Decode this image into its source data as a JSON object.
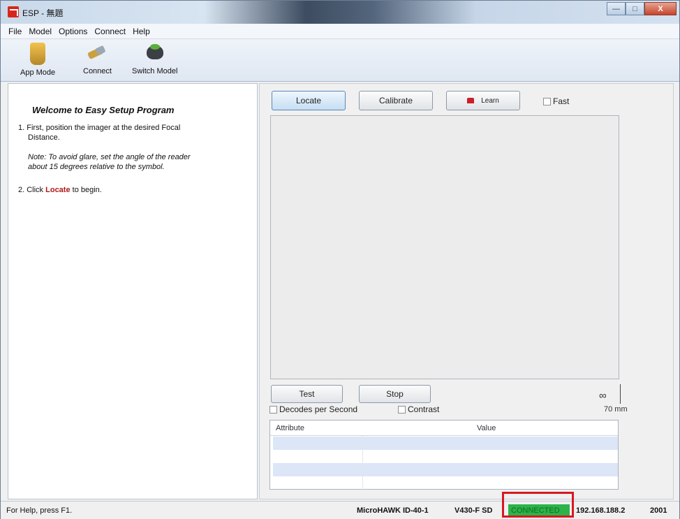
{
  "window": {
    "title": "ESP - 無題",
    "minimize": "—",
    "maximize": "□",
    "close": "X"
  },
  "menu": [
    "File",
    "Model",
    "Options",
    "Connect",
    "Help"
  ],
  "toolbar": {
    "app_mode": "App Mode",
    "connect": "Connect",
    "switch_model": "Switch Model"
  },
  "left": {
    "welcome": "Welcome to Easy Setup Program",
    "step1_line1": "1. First, position the imager at the desired Focal",
    "step1_line2": "Distance.",
    "note_line1": "Note: To avoid glare, set the angle of the reader",
    "note_line2": "about 15 degrees relative to the symbol.",
    "step2_prefix": "2. Click ",
    "step2_locate": "Locate",
    "step2_suffix": " to begin."
  },
  "right": {
    "locate": "Locate",
    "calibrate": "Calibrate",
    "learn": "Learn",
    "fast": "Fast",
    "test": "Test",
    "stop": "Stop",
    "decodes_per_second": "Decodes per Second",
    "contrast": "Contrast",
    "focus_distance": "70 mm",
    "focus_icon": "glasses-icon",
    "table": {
      "columns": [
        "Attribute",
        "Value"
      ],
      "rows": [
        [
          "",
          ""
        ],
        [
          "",
          ""
        ],
        [
          "",
          ""
        ],
        [
          "",
          ""
        ]
      ]
    }
  },
  "status": {
    "help": "For Help, press F1.",
    "model": "MicroHAWK ID-40-1",
    "firmware": "V430-F SD",
    "connection": "CONNECTED",
    "ip": "192.168.188.2",
    "port": "2001"
  },
  "colors": {
    "connected_bg": "#2cb34a",
    "highlight": "#d71920",
    "locate_text": "#b01818"
  }
}
